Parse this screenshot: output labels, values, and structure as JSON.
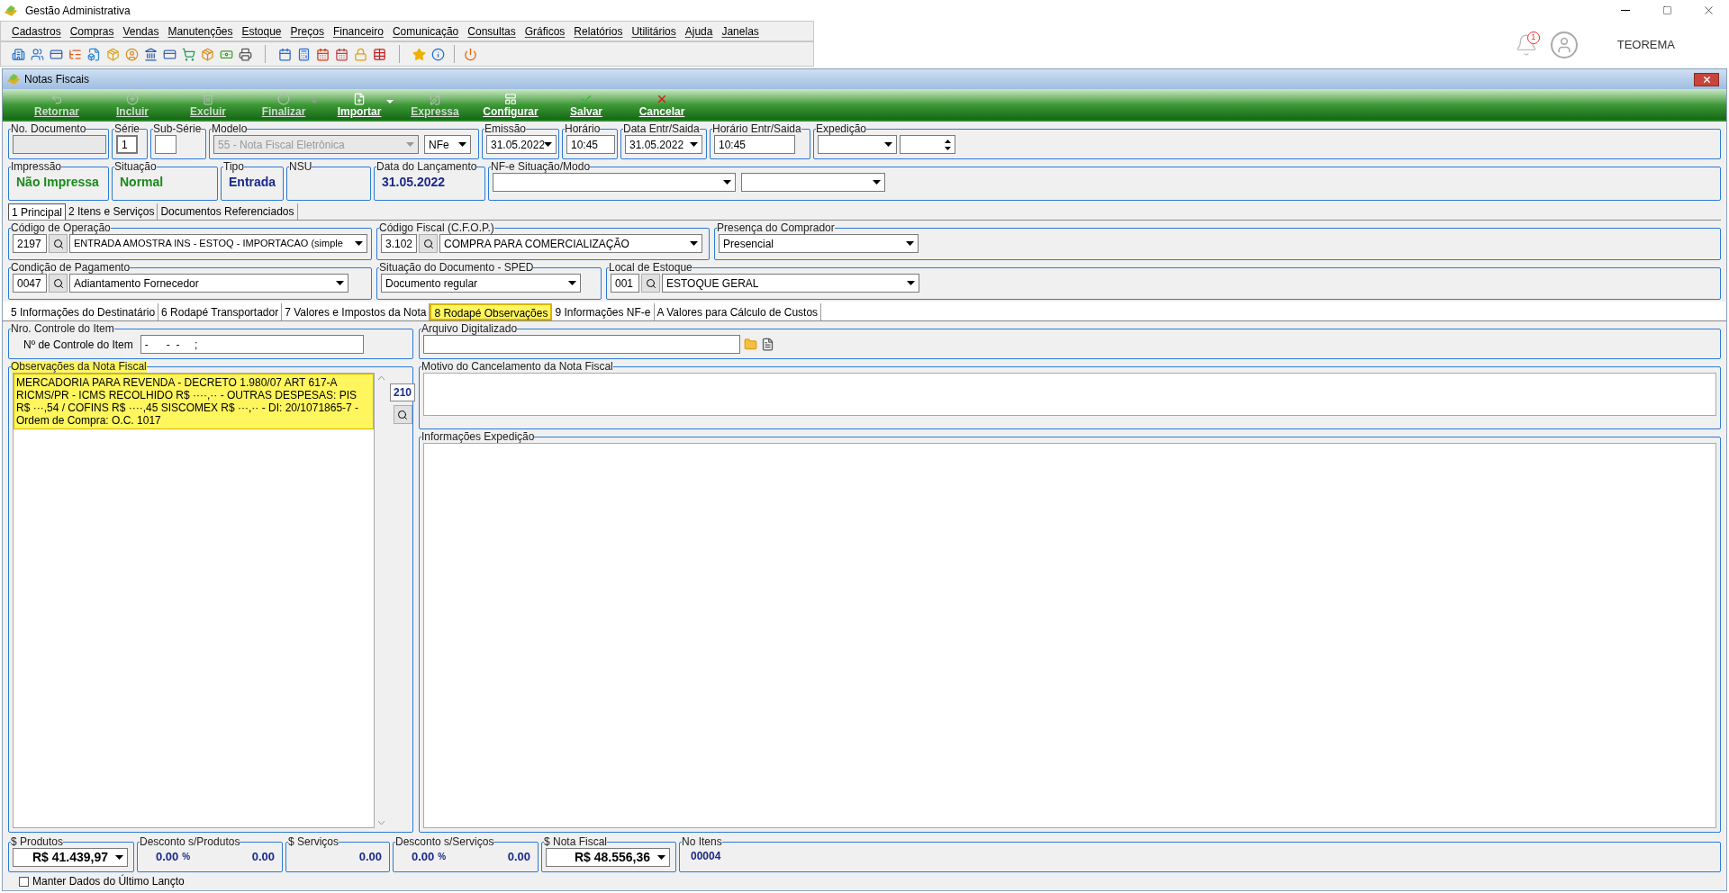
{
  "window": {
    "title": "Gestão Administrativa"
  },
  "menu": [
    "Cadastros",
    "Compras",
    "Vendas",
    "Manutenções",
    "Estoque",
    "Preços",
    "Financeiro",
    "Comunicação",
    "Consultas",
    "Gráficos",
    "Relatórios",
    "Utilitários",
    "Ajuda",
    "Janelas"
  ],
  "top_right": {
    "notifications": "1",
    "user": "TEOREMA"
  },
  "form": {
    "title": "Notas Fiscais"
  },
  "actions": [
    {
      "label": "Retornar",
      "disabled": true,
      "dropdown": false
    },
    {
      "label": "Incluir",
      "disabled": true,
      "dropdown": false
    },
    {
      "label": "Excluir",
      "disabled": true,
      "dropdown": false
    },
    {
      "label": "Finalizar",
      "disabled": true,
      "dropdown": true
    },
    {
      "label": "Importar",
      "disabled": false,
      "dropdown": true
    },
    {
      "label": "Expressa",
      "disabled": true,
      "dropdown": false
    },
    {
      "label": "Configurar",
      "disabled": false,
      "dropdown": false
    },
    {
      "label": "Salvar",
      "disabled": false,
      "dropdown": false
    },
    {
      "label": "Cancelar",
      "disabled": false,
      "dropdown": false
    }
  ],
  "header": {
    "no_documento": {
      "label": "No. Documento"
    },
    "serie": {
      "label": "Série",
      "value": "1"
    },
    "sub_serie": {
      "label": "Sub-Série"
    },
    "modelo": {
      "label": "Modelo",
      "value": "55 - Nota Fiscal Eletrônica",
      "type": "NFe"
    },
    "emissao": {
      "label": "Emissão",
      "value": "31.05.2022"
    },
    "horario": {
      "label": "Horário",
      "value": "10:45"
    },
    "data_entr": {
      "label": "Data Entr/Saida",
      "value": "31.05.2022"
    },
    "horario_entr": {
      "label": "Horário Entr/Saida",
      "value": "10:45"
    },
    "expedicao": {
      "label": "Expedição"
    }
  },
  "status": {
    "impressao": {
      "label": "Impressão",
      "value": "Não Impressa"
    },
    "situacao": {
      "label": "Situação",
      "value": "Normal"
    },
    "tipo": {
      "label": "Tipo",
      "value": "Entrada"
    },
    "nsu": {
      "label": "NSU"
    },
    "data_lancamento": {
      "label": "Data do Lançamento",
      "value": "31.05.2022"
    },
    "nfe_situacao": {
      "label": "NF-e Situação/Modo"
    }
  },
  "tabs": [
    {
      "label": "1 Principal",
      "selected": true
    },
    {
      "label": "2 Itens e Serviços",
      "selected": false
    },
    {
      "label": "Documentos Referenciados",
      "selected": false
    }
  ],
  "principal": {
    "operacao": {
      "label": "Código de Operação",
      "code": "2197",
      "value": "ENTRADA AMOSTRA INS - ESTOQ - IMPORTACAO (simple"
    },
    "cfop": {
      "label": "Código Fiscal (C.F.O.P.)",
      "code": "3.102",
      "value": "COMPRA PARA COMERCIALIZAÇÃO"
    },
    "presenca": {
      "label": "Presença do Comprador",
      "value": "Presencial"
    },
    "pagamento": {
      "label": "Condição de Pagamento",
      "code": "0047",
      "value": "Adiantamento Fornecedor"
    },
    "sped": {
      "label": "Situação do Documento - SPED",
      "value": "Documento regular"
    },
    "estoque": {
      "label": "Local de Estoque",
      "code": "001",
      "value": "ESTOQUE GERAL"
    }
  },
  "subtabs": [
    {
      "label": "5 Informações do Destinatário",
      "selected": false
    },
    {
      "label": "6 Rodapé Transportador",
      "selected": false
    },
    {
      "label": "7 Valores e Impostos da Nota",
      "selected": false
    },
    {
      "label": "8 Rodapé Observações",
      "selected": true
    },
    {
      "label": "9 Informações NF-e",
      "selected": false
    },
    {
      "label": "A Valores para Cálculo de Custos",
      "selected": false
    }
  ],
  "controle": {
    "group": "Nro. Controle do Item",
    "label": "Nº de Controle do Item",
    "value": "-      -  -     ;"
  },
  "arquivo": {
    "label": "Arquivo Digitalizado"
  },
  "observacoes": {
    "label": "Observações da Nota Fiscal",
    "text": "MERCADORIA PARA REVENDA - DECRETO 1.980/07 ART 617-A RICMS/PR - ICMS RECOLHIDO  R$ ····,·· - OUTRAS DESPESAS: PIS R$ ···,54 / COFINS R$ ····,45 SISCOMEX R$ ···,·· - DI: 20/1071865-7 - Ordem de Compra: O.C. 1017",
    "count": "210"
  },
  "cancelamento": {
    "label": "Motivo do Cancelamento da Nota Fiscal"
  },
  "expedicao_info": {
    "label": "Informações Expedição"
  },
  "totals": {
    "produtos": {
      "label": "$ Produtos",
      "value": "R$ 41.439,97"
    },
    "desc_produtos": {
      "label": "Desconto s/Produtos",
      "percent": "0.00",
      "pct": "%",
      "value": "0.00"
    },
    "servicos": {
      "label": "$ Serviços",
      "value": "0.00"
    },
    "desc_servicos": {
      "label": "Desconto s/Serviços",
      "percent": "0.00",
      "pct": "%",
      "value": "0.00"
    },
    "nota": {
      "label": "$ Nota Fiscal",
      "value": "R$ 48.556,36"
    },
    "itens": {
      "label": "No Itens",
      "value": "00004"
    }
  },
  "keep_last": {
    "label": "Manter Dados do Último Lançto",
    "checked": false
  }
}
